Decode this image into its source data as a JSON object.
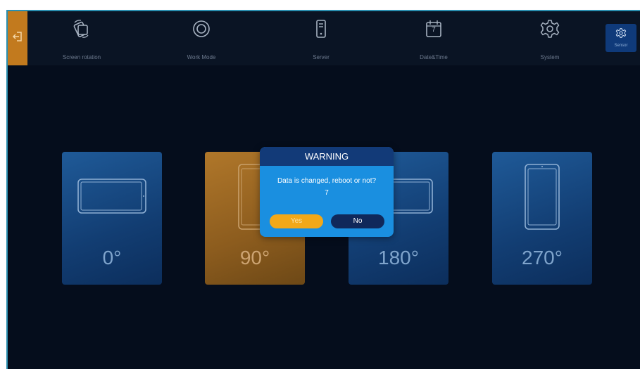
{
  "nav": {
    "items": [
      {
        "label": "Screen rotation",
        "icon": "screen-rotation-icon"
      },
      {
        "label": "Work Mode",
        "icon": "work-mode-icon"
      },
      {
        "label": "Server",
        "icon": "server-icon"
      },
      {
        "label": "Date&Time",
        "icon": "calendar-icon",
        "icon_text": "7"
      },
      {
        "label": "System",
        "icon": "gear-icon"
      }
    ],
    "active": {
      "label": "Sensor",
      "icon": "sensor-gear-icon"
    },
    "back_icon": "exit-icon"
  },
  "rotation": {
    "options": [
      {
        "degrees": "0°",
        "selected": false
      },
      {
        "degrees": "90°",
        "selected": true
      },
      {
        "degrees": "180°",
        "selected": false
      },
      {
        "degrees": "270°",
        "selected": false
      }
    ]
  },
  "dialog": {
    "title": "WARNING",
    "message": "Data is changed, reboot or not?",
    "countdown": "7",
    "yes_label": "Yes",
    "no_label": "No"
  },
  "colors": {
    "background": "#050d1c",
    "topbar": "#0a1424",
    "accent_orange": "#c27a1e",
    "card_blue": "#1f5a98",
    "dialog_blue": "#1a8fe0",
    "dialog_header": "#123a78",
    "yes_button": "#f2a818",
    "no_button": "#10285a"
  }
}
